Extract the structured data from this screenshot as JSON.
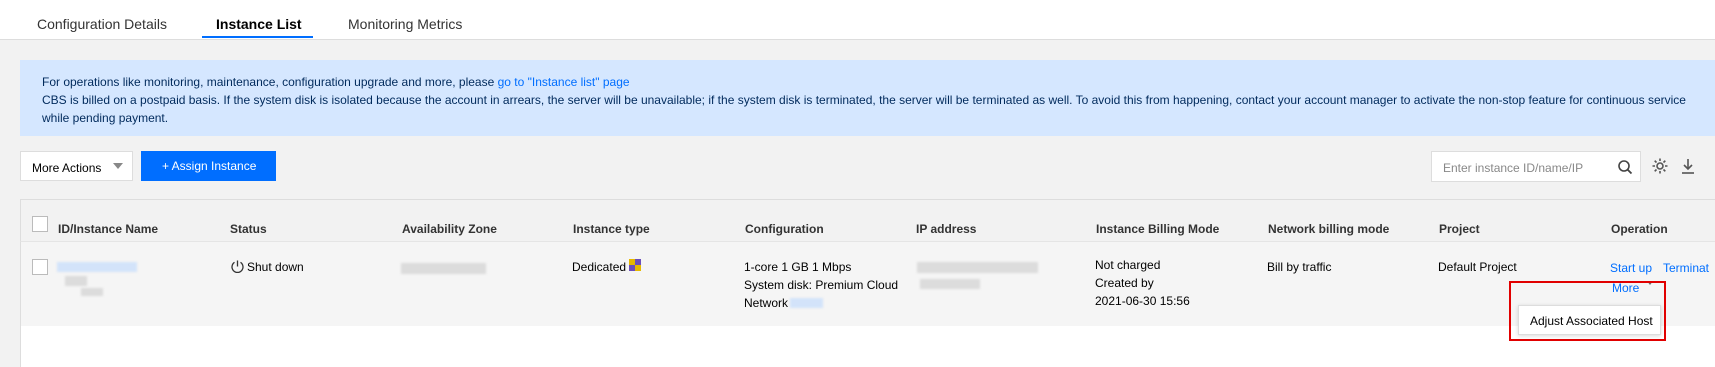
{
  "tabs": [
    {
      "label": "Configuration Details"
    },
    {
      "label": "Instance List",
      "active": true
    },
    {
      "label": "Monitoring Metrics"
    }
  ],
  "banner": {
    "line1_text": "For operations like monitoring, maintenance, configuration upgrade and more, please ",
    "line1_link": "go to \"Instance list\" page",
    "line2": "CBS is billed on a postpaid basis. If the system disk is isolated because the account in arrears, the server will be unavailable; if the system disk is terminated, the server will be terminated as well. To avoid this from happening, contact your account manager to activate the non-stop feature for continuous service while pending payment."
  },
  "toolbar": {
    "more_actions": "More Actions",
    "assign": "+ Assign Instance",
    "search_placeholder": "Enter instance ID/name/IP"
  },
  "columns": [
    "ID/Instance Name",
    "Status",
    "Availability Zone",
    "Instance type",
    "Configuration",
    "IP address",
    "Instance Billing Mode",
    "Network billing mode",
    "Project",
    "Operation"
  ],
  "row": {
    "status": "Shut down",
    "instance_type": "Dedicated",
    "config_line1": "1-core 1 GB 1 Mbps",
    "config_line2": "System disk: Premium Cloud",
    "config_line3": "Network",
    "billing_line1": "Not charged",
    "billing_line2": "Created by",
    "billing_line3": "2021-06-30 15:56",
    "network_billing": "Bill by traffic",
    "project": "Default Project",
    "op_startup": "Start up",
    "op_terminate": "Terminat",
    "op_more": "More"
  },
  "popover": {
    "label": "Adjust Associated Host"
  },
  "colors": {
    "accent": "#006eff",
    "banner_bg": "#d5e7ff",
    "highlight": "#e10000"
  }
}
